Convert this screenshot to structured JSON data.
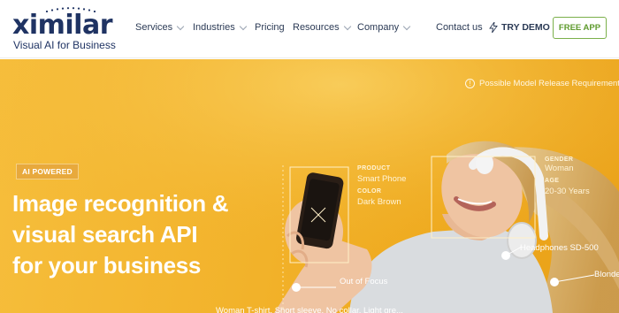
{
  "brand": {
    "name": "ximilar",
    "tagline": "Visual AI for Business"
  },
  "nav": {
    "items": [
      {
        "label": "Services",
        "has_dropdown": true
      },
      {
        "label": "Industries",
        "has_dropdown": true
      },
      {
        "label": "Pricing",
        "has_dropdown": false
      },
      {
        "label": "Resources",
        "has_dropdown": true
      },
      {
        "label": "Company",
        "has_dropdown": true
      }
    ],
    "contact": "Contact us",
    "try_demo": "TRY DEMO",
    "free_app": "FREE APP"
  },
  "hero": {
    "badge": "AI POWERED",
    "headline": [
      "Image recognition &",
      "visual search API",
      "for your business"
    ],
    "model_release": "Possible Model Release Requirement",
    "tags": {
      "product_label": "PRODUCT",
      "product_value": "Smart Phone",
      "color_label": "COLOR",
      "color_value": "Dark Brown",
      "gender_label": "GENDER",
      "gender_value": "Woman",
      "age_label": "AGE",
      "age_value": "20-30 Years",
      "headphones": "Headphones SD-500",
      "out_of_focus": "Out of Focus",
      "blonde": "Blonde",
      "bottom_caption": "Woman T-shirt, Short sleeve, No collar, Light gre..."
    }
  },
  "colors": {
    "navy": "#1f3363",
    "accent_green": "#7bb04a",
    "hero_yellow": "#f2b22a"
  }
}
